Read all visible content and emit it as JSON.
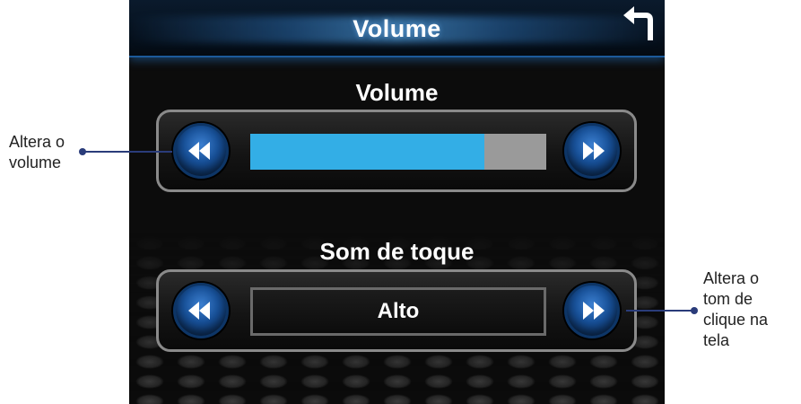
{
  "header": {
    "title": "Volume",
    "back_icon": "return-arrow-icon"
  },
  "volume": {
    "label": "Volume",
    "level": 0.79,
    "fill_color": "#33aee6",
    "track_color": "#9a9a9a",
    "decrease_icon": "rewind-icon",
    "increase_icon": "fast-forward-icon"
  },
  "touch_sound": {
    "label": "Som de toque",
    "value": "Alto",
    "decrease_icon": "rewind-icon",
    "increase_icon": "fast-forward-icon"
  },
  "callouts": {
    "volume_line1": "Altera o",
    "volume_line2": "volume",
    "tone_line1": "Altera o",
    "tone_line2": "tom de",
    "tone_line3": "clique na",
    "tone_line4": "tela"
  },
  "colors": {
    "accent": "#1c5a9a",
    "callout": "#2a3c7a"
  }
}
